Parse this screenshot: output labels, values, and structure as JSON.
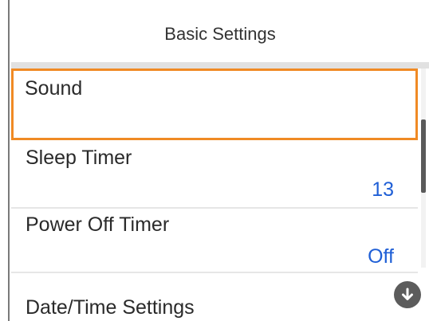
{
  "header": {
    "title": "Basic Settings"
  },
  "items": [
    {
      "label": "Sound",
      "value": ""
    },
    {
      "label": "Sleep Timer",
      "value": "13"
    },
    {
      "label": "Power Off Timer",
      "value": "Off"
    },
    {
      "label": "Date/Time Settings",
      "value": ""
    }
  ],
  "scroll": {
    "down_icon": "arrow-down-circle-icon"
  },
  "colors": {
    "selection": "#f08a24",
    "value": "#1f5fd6",
    "scrollbar": "#5a5a5a"
  }
}
